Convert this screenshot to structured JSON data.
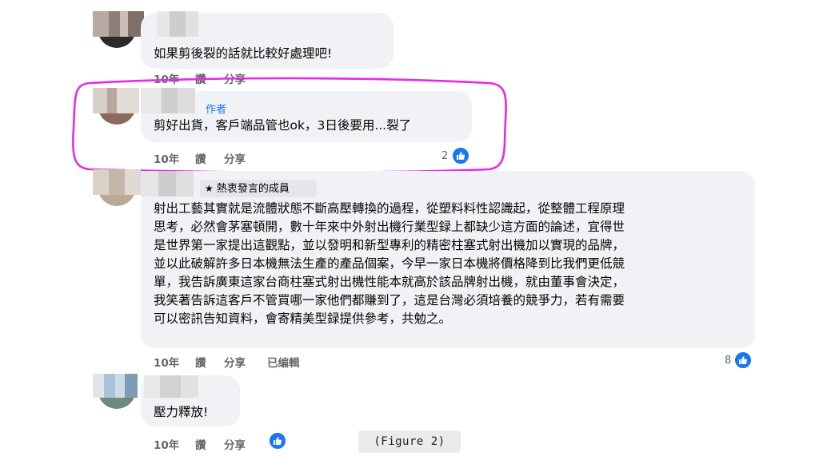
{
  "comments": [
    {
      "text": "如果剪後裂的話就比較好處理吧!",
      "age": "10年",
      "like_label": "讚",
      "share_label": "分享"
    },
    {
      "author_tag": "作者",
      "text": "剪好出貨，客戶端品管也ok，3日後要用...裂了",
      "age": "10年",
      "like_label": "讚",
      "share_label": "分享",
      "reactions": "2"
    },
    {
      "badge": "熱衷發言的成員",
      "lines": [
        "射出工藝其實就是流體狀態不斷高壓轉換的過程，從塑料料性認識起，從整體工程原理",
        "思考，必然會茅塞頓開，數十年來中外射出機行業型録上都缺少這方面的論述，宜得世",
        "是世界第一家提出這觀點，並以發明和新型專利的精密柱塞式射出機加以實現的品牌，",
        "並以此破解許多日本機無法生產的產品個案，今早一家日本機將價格降到比我們更低競",
        "單，我告訴廣東這家台商柱塞式射出機性能本就高於該品牌射出機，就由董事會決定，",
        "我笑著告訴這客戶不管買哪一家他們都賺到了，這是台灣必須培養的競爭力，若有需要",
        "可以密訊告知資料，會寄精美型録提供參考，共勉之。"
      ],
      "age": "10年",
      "like_label": "讚",
      "share_label": "分享",
      "edited_label": "已编輯",
      "reactions": "8"
    },
    {
      "text": "壓力釋放!",
      "age": "10年",
      "like_label": "讚",
      "share_label": "分享"
    }
  ],
  "caption": "(Figure 2)",
  "colors": {
    "bubble": "#f0f2f5",
    "link_blue": "#1877f2",
    "meta_gray": "#65676b",
    "highlight_magenta": "#e62be6"
  },
  "icons": [
    "like-icon",
    "star-icon",
    "avatar"
  ]
}
